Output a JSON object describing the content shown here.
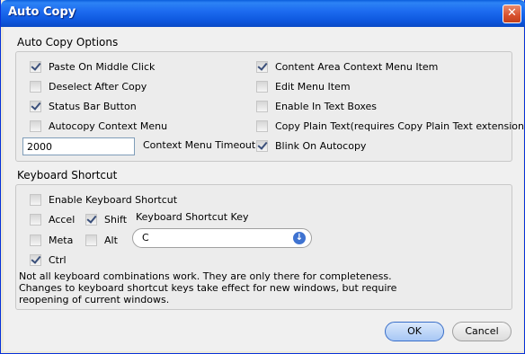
{
  "window": {
    "title": "Auto Copy"
  },
  "options_group": {
    "title": "Auto Copy Options",
    "left": [
      {
        "label": "Paste On Middle Click",
        "checked": true
      },
      {
        "label": "Deselect After Copy",
        "checked": false
      },
      {
        "label": "Status Bar Button",
        "checked": true
      },
      {
        "label": "Autocopy Context Menu",
        "checked": false
      }
    ],
    "right": [
      {
        "label": "Content Area Context Menu Item",
        "checked": true
      },
      {
        "label": "Edit Menu Item",
        "checked": false
      },
      {
        "label": "Enable In Text Boxes",
        "checked": false
      },
      {
        "label": "Copy Plain Text(requires Copy Plain Text extension)",
        "checked": false
      },
      {
        "label": "Blink On Autocopy",
        "checked": true
      }
    ],
    "timeout_value": "2000",
    "timeout_label": "Context Menu Timeout"
  },
  "keyboard_group": {
    "title": "Keyboard Shortcut",
    "enable": {
      "label": "Enable Keyboard Shortcut",
      "checked": false
    },
    "accel": {
      "label": "Accel",
      "checked": false
    },
    "shift": {
      "label": "Shift",
      "checked": true
    },
    "meta": {
      "label": "Meta",
      "checked": false
    },
    "alt": {
      "label": "Alt",
      "checked": false
    },
    "ctrl": {
      "label": "Ctrl",
      "checked": true
    },
    "key_label": "Keyboard Shortcut Key",
    "key_value": "C",
    "note_line1": "Not all keyboard combinations work. They are only there for completeness.",
    "note_line2": "Changes to keyboard shortcut keys take effect for new windows, but require",
    "note_line3": "reopening of current windows."
  },
  "buttons": {
    "ok": "OK",
    "cancel": "Cancel"
  }
}
